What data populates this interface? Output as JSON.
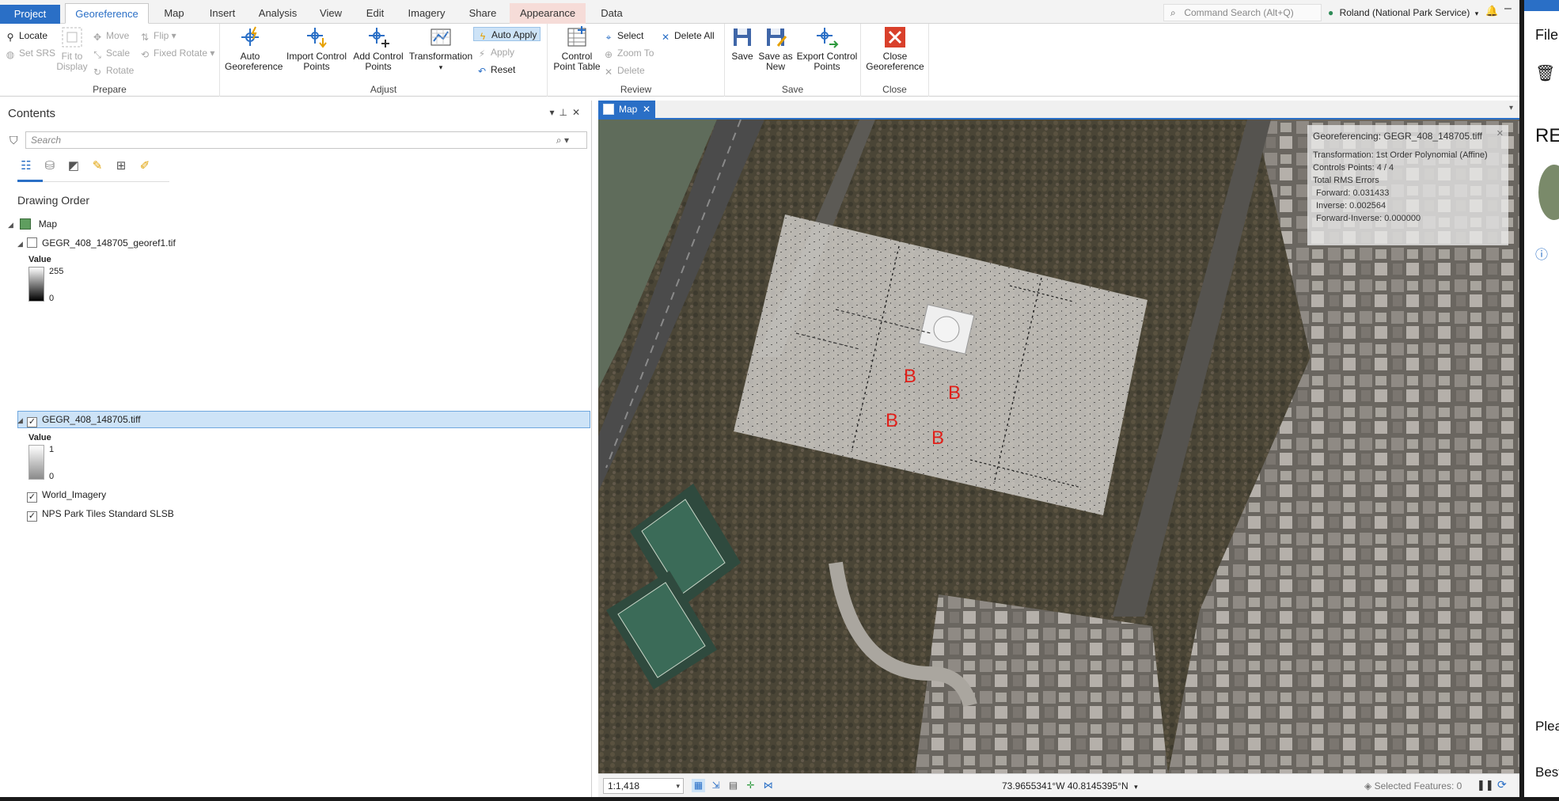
{
  "ribbon_tabs": [
    "Project",
    "Georeference",
    "Map",
    "Insert",
    "Analysis",
    "View",
    "Edit",
    "Imagery",
    "Share",
    "Appearance",
    "Data"
  ],
  "active_tab": "Georeference",
  "command_search": {
    "placeholder": "Command Search (Alt+Q)"
  },
  "user": {
    "name": "Roland (National Park Service)"
  },
  "groups": {
    "prepare": {
      "label": "Prepare",
      "locate": "Locate",
      "set_srs": "Set SRS",
      "fit_to_display": "Fit to Display",
      "move": "Move",
      "scale": "Scale",
      "rotate": "Rotate",
      "flip": "Flip",
      "fixed_rotate": "Fixed Rotate"
    },
    "adjust": {
      "label": "Adjust",
      "auto_georeference": "Auto Georeference",
      "import_control_points": "Import Control Points",
      "add_control_points": "Add Control Points",
      "transformation": "Transformation",
      "auto_apply": "Auto Apply",
      "apply": "Apply",
      "reset": "Reset"
    },
    "review": {
      "label": "Review",
      "control_point_table": "Control Point Table",
      "select": "Select",
      "zoom_to": "Zoom To",
      "delete": "Delete",
      "delete_all": "Delete All"
    },
    "save": {
      "label": "Save",
      "save": "Save",
      "save_as_new": "Save as New",
      "export_control_points": "Export Control Points"
    },
    "close": {
      "label": "Close",
      "close_georeference": "Close Georeference"
    }
  },
  "contents": {
    "title": "Contents",
    "search_placeholder": "Search",
    "drawing_order": "Drawing Order",
    "map_label": "Map",
    "layers": [
      {
        "name": "GEGR_408_148705_georef1.tif",
        "checked": false,
        "legend_title": "Value",
        "legend_max": "255",
        "legend_min": "0"
      },
      {
        "name": "GEGR_408_148705.tiff",
        "checked": true,
        "selected": true,
        "legend_title": "Value",
        "legend_max": "1",
        "legend_min": "0"
      },
      {
        "name": "World_Imagery",
        "checked": true
      },
      {
        "name": "NPS Park Tiles Standard SLSB",
        "checked": true
      }
    ]
  },
  "map_tab": {
    "label": "Map"
  },
  "georef_info": {
    "title": "Georeferencing: GEGR_408_148705.tiff",
    "transformation": "Transformation: 1st Order Polynomial (Affine)",
    "control_points": "Controls Points: 4 / 4",
    "rms_header": "Total RMS Errors",
    "forward": "Forward: 0.031433",
    "inverse": "Inverse: 0.002564",
    "forward_inverse": "Forward-Inverse: 0.000000"
  },
  "control_point_markers": [
    "B",
    "B",
    "B",
    "B"
  ],
  "status": {
    "scale": "1:1,418",
    "coordinates": "73.9655341°W 40.8145395°N",
    "selected_features": "Selected Features: 0"
  },
  "right_window": {
    "t1": "File",
    "t2": "RE",
    "t3": "Plea",
    "t4": "Best"
  },
  "colors": {
    "accent": "#2a6fc6",
    "marker_red": "#e0201a",
    "selection": "#cde3f7"
  }
}
